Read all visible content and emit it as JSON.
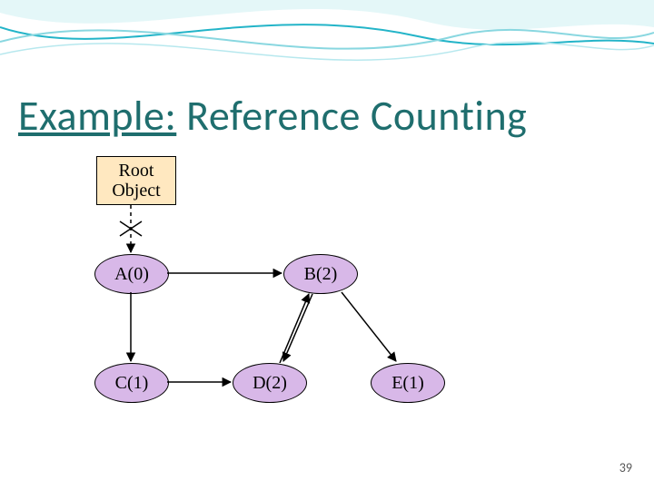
{
  "title_underlined": "Example:",
  "title_rest": " Reference Counting",
  "root_label_line1": "Root",
  "root_label_line2": "Object",
  "nodes": {
    "A": "A(0)",
    "B": "B(2)",
    "C": "C(1)",
    "D": "D(2)",
    "E": "E(1)"
  },
  "page_number": "39",
  "chart_data": {
    "type": "table",
    "title": "Reference Counting example graph",
    "objects": [
      {
        "name": "Root Object",
        "outgoing_refs": [
          "A"
        ]
      },
      {
        "name": "A",
        "ref_count": 0,
        "outgoing_refs": [
          "C",
          "B"
        ]
      },
      {
        "name": "B",
        "ref_count": 2,
        "outgoing_refs": [
          "D",
          "E"
        ]
      },
      {
        "name": "C",
        "ref_count": 1,
        "outgoing_refs": [
          "D"
        ]
      },
      {
        "name": "D",
        "ref_count": 2,
        "outgoing_refs": [
          "B"
        ]
      },
      {
        "name": "E",
        "ref_count": 1,
        "outgoing_refs": []
      }
    ],
    "note": "Root→A edge is shown crossed out (dashed/removed)"
  }
}
